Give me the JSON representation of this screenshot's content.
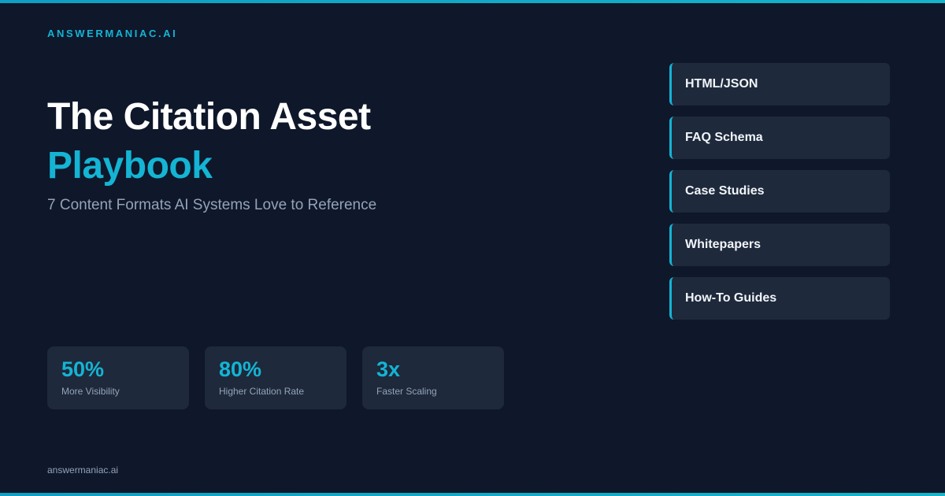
{
  "brand": "ANSWERMANIAC.AI",
  "title": {
    "line1": "The Citation Asset",
    "line2": "Playbook"
  },
  "subtitle": "7 Content Formats AI Systems Love to Reference",
  "stats": [
    {
      "value": "50%",
      "label": "More Visibility"
    },
    {
      "value": "80%",
      "label": "Higher Citation Rate"
    },
    {
      "value": "3x",
      "label": "Faster Scaling"
    }
  ],
  "formats": [
    {
      "label": "HTML/JSON"
    },
    {
      "label": "FAQ Schema"
    },
    {
      "label": "Case Studies"
    },
    {
      "label": "Whitepapers"
    },
    {
      "label": "How-To Guides"
    }
  ],
  "footer": "answermaniac.ai",
  "colors": {
    "background": "#0f172a",
    "panel": "#1e293b",
    "accent": "#14b4d4",
    "muted_text": "#94a3b8",
    "heading_text": "#ffffff"
  }
}
